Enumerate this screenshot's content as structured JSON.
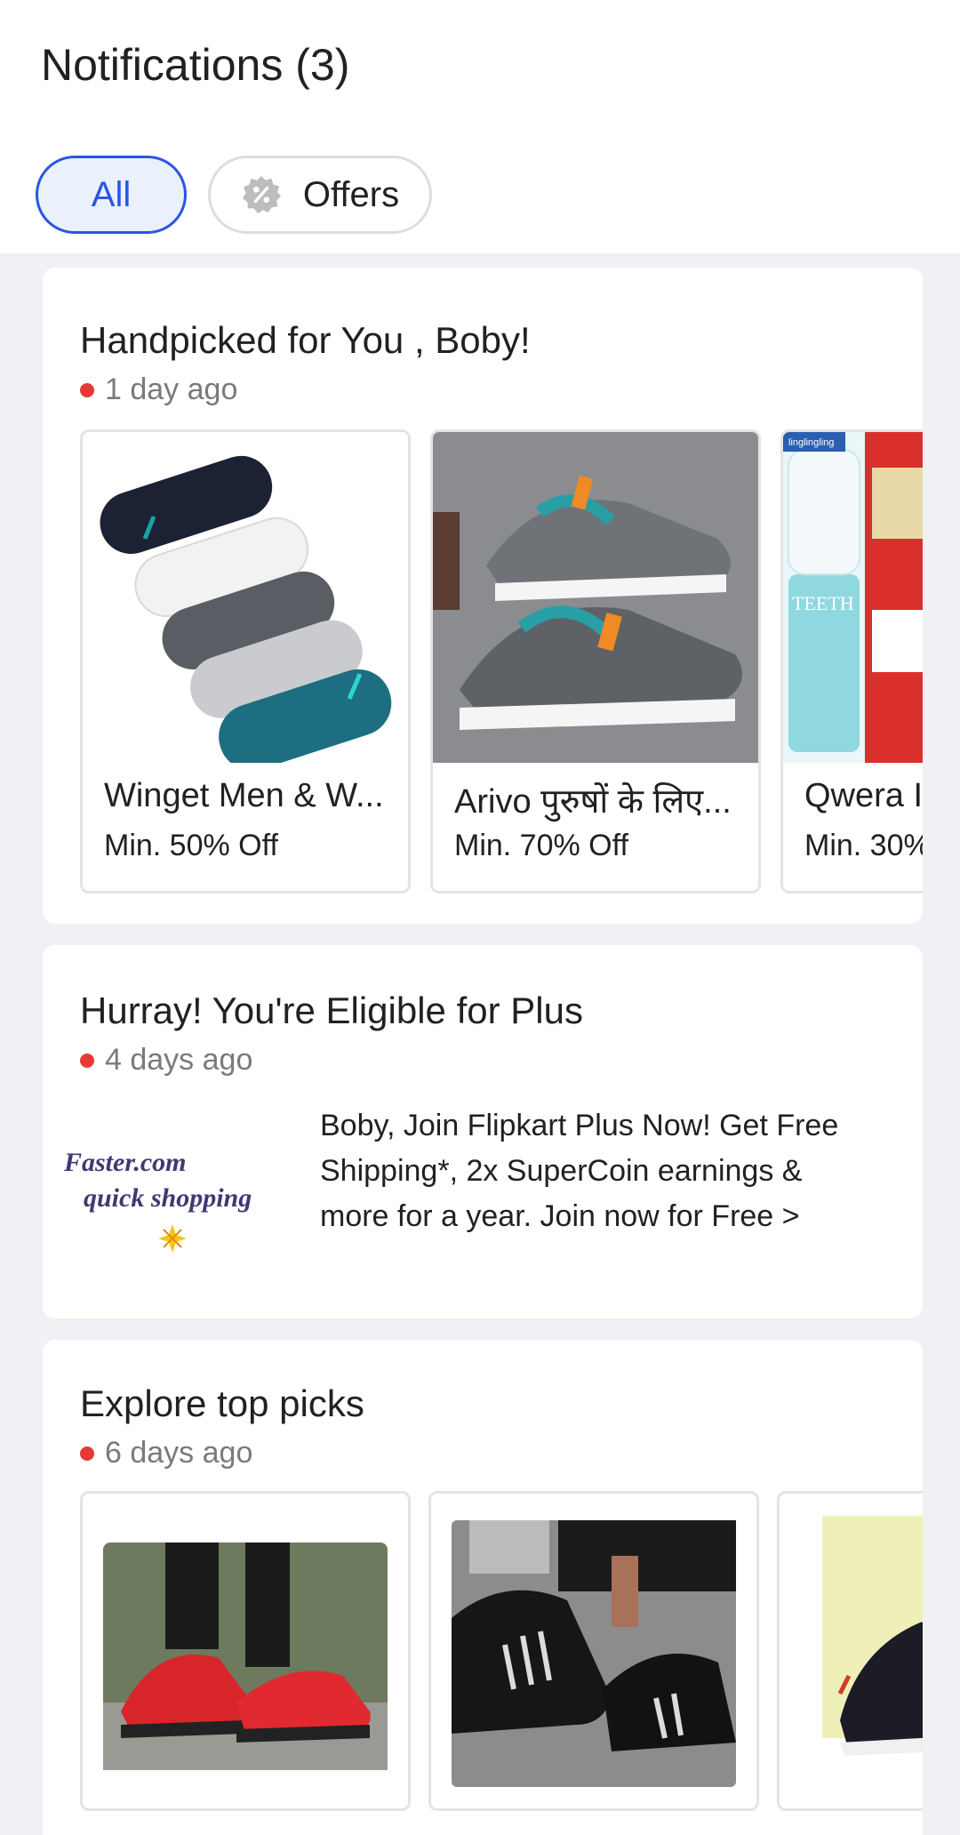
{
  "header": {
    "title": "Notifications (3)",
    "filters": [
      {
        "label": "All",
        "selected": true
      },
      {
        "label": "Offers",
        "selected": false,
        "icon": "offer-badge-icon"
      }
    ]
  },
  "notifications": [
    {
      "title": "Handpicked for You , Boby!",
      "time": "1 day ago",
      "products": [
        {
          "name": "Winget Men & W...",
          "offer": "Min. 50% Off",
          "image": "socks-image"
        },
        {
          "name": "Arivo पुरुषों के लिए...",
          "offer": "Min. 70% Off",
          "image": "sneakers-image"
        },
        {
          "name": "Qwera I",
          "offer": "Min. 30%",
          "image": "teeth-whitening-image",
          "image_text": "TEETH",
          "brand_text": "linglingling"
        }
      ]
    },
    {
      "title": "Hurray! You're Eligible for Plus",
      "time": "4 days ago",
      "logo_lines": [
        "Faster.com",
        "quick shopping"
      ],
      "message": "Boby, Join Flipkart Plus Now! Get Free Shipping*, 2x SuperCoin earnings & more for a year. Join now for Free >"
    },
    {
      "title": "Explore top picks",
      "time": "6 days ago",
      "products": [
        {
          "image": "red-sneakers-image"
        },
        {
          "image": "black-sneakers-image"
        },
        {
          "image": "black-shoe-image"
        }
      ]
    }
  ],
  "colors": {
    "accent": "#2a55e5",
    "unread_dot": "#e53935",
    "feed_background": "#f0f1f4"
  }
}
